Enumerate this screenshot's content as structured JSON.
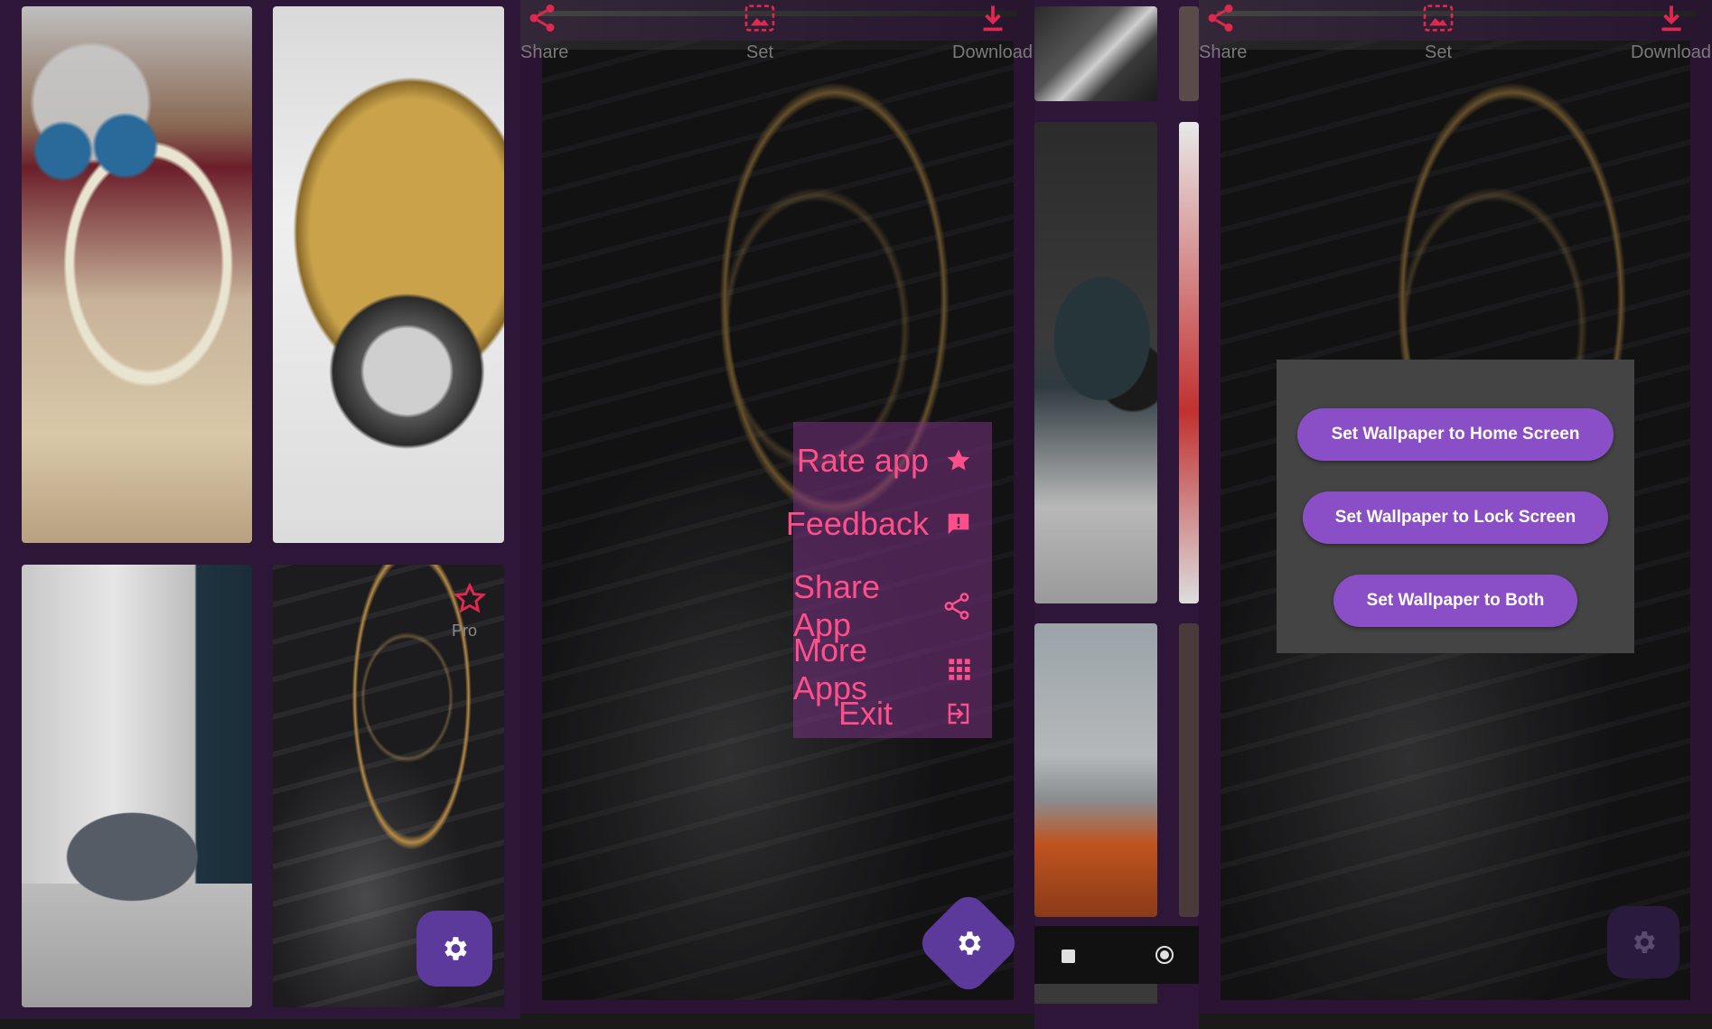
{
  "colors": {
    "frame": "#2e1638",
    "accent_pink": "#ff4f8b",
    "accent_red": "#e0284f",
    "fab": "#5b3a9b",
    "dialog_bg": "#444",
    "pill": "#8a4fc7"
  },
  "grid_screen": {
    "pro_label": "Pro",
    "fab_icon": "gear-icon"
  },
  "viewer_screen": {
    "top_actions": [
      {
        "label": "Share",
        "icon": "share-icon"
      },
      {
        "label": "Set",
        "icon": "image-icon"
      },
      {
        "label": "Download",
        "icon": "download-icon"
      }
    ],
    "menu": [
      {
        "label": "Rate app",
        "icon": "star-icon"
      },
      {
        "label": "Feedback",
        "icon": "feedback-icon"
      },
      {
        "label": "Share App",
        "icon": "share-icon"
      },
      {
        "label": "More Apps",
        "icon": "apps-grid-icon"
      },
      {
        "label": "Exit",
        "icon": "exit-icon"
      }
    ]
  },
  "dialog_screen": {
    "top_actions": [
      {
        "label": "Share"
      },
      {
        "label": "Set"
      },
      {
        "label": "Download"
      }
    ],
    "buttons": [
      "Set Wallpaper to Home Screen",
      "Set Wallpaper to Lock Screen",
      "Set Wallpaper to Both"
    ]
  }
}
